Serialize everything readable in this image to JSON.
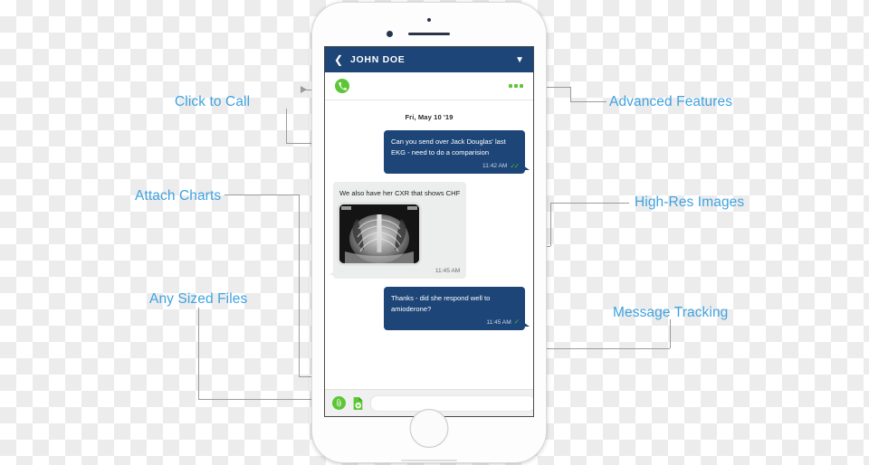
{
  "annotations": [
    {
      "id": "click-to-call",
      "label": "Click to Call"
    },
    {
      "id": "attach-charts",
      "label": "Attach Charts"
    },
    {
      "id": "any-sized-files",
      "label": "Any Sized Files"
    },
    {
      "id": "advanced-features",
      "label": "Advanced Features"
    },
    {
      "id": "high-res-images",
      "label": "High-Res Images"
    },
    {
      "id": "message-tracking",
      "label": "Message Tracking"
    }
  ],
  "colors": {
    "label_blue": "#3fa2e0",
    "navy": "#1d4578",
    "green": "#5cc636",
    "tick_green": "#45c12a",
    "connector_gray": "#9b9b9b",
    "incoming_bubble": "#eceded"
  },
  "phone": {
    "navbar": {
      "back_icon": "chevron-left-icon",
      "title": "JOHN DOE",
      "menu_icon": "chevron-down-icon"
    },
    "actionbar": {
      "call_icon": "phone-icon",
      "more_icon": "more-options-icon"
    },
    "thread": {
      "date_separator": "Fri, May 10 '19",
      "messages": [
        {
          "direction": "outgoing",
          "text": "Can you send over Jack Douglas' last EKG - need to do a comparision",
          "time": "11:42 AM",
          "status_icon": "double-check-icon",
          "has_image": false
        },
        {
          "direction": "incoming",
          "text": "We also have her CXR that shows CHF",
          "time": "11:45 AM",
          "status_icon": "",
          "has_image": true,
          "image_name": "chest-xray-image"
        },
        {
          "direction": "outgoing",
          "text": "Thanks - did she respond well to amioderone?",
          "time": "11:45 AM",
          "status_icon": "single-check-icon",
          "has_image": false
        }
      ]
    },
    "composer": {
      "attach_icon": "paperclip-icon",
      "file_icon": "add-file-icon",
      "input_value": "",
      "input_placeholder": "",
      "send_icon": "send-icon"
    }
  }
}
